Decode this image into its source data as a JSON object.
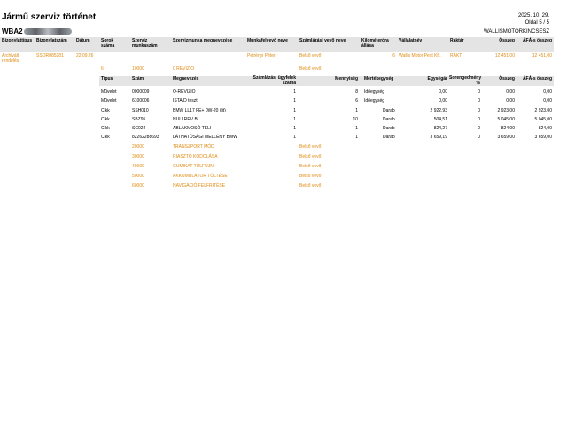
{
  "doc": {
    "title": "Jármű szerviz történet",
    "vin_prefix": "WBA2",
    "date": "2025. 10. 29.",
    "page": "Oldal 5 / 5",
    "company": "WALLISMOTORKINCSESZ"
  },
  "main_headers": {
    "type": "Bizonylattípus",
    "number": "Bizonylatszám",
    "date": "Dátum",
    "lines": "Sorok száma",
    "service_no": "Szerviz munkaszám",
    "service_name": "Szervizmunka megnevezése",
    "receiver": "Munkafelvevő neve",
    "customer": "Számlázási vevő neve",
    "km": "Kilométeróra állása",
    "company": "Vállalatnév",
    "warehouse": "Raktár",
    "total": "Összeg",
    "total_vat": "ÁFÁ-s összeg"
  },
  "doc_row": {
    "type": "Archivált rendelés",
    "number": "SSOR085281",
    "date": "22.09.26",
    "receiver": "Petrényi Péter",
    "customer": "Belső vevő",
    "km": "6",
    "company": "Wallis Motor Pest Kft.",
    "warehouse": "RAKT",
    "total": "12 451,00",
    "total_vat": "12 451,00"
  },
  "job_first": {
    "lines": "6",
    "service_no": "10000",
    "service_name": "0 REVÍZIÓ",
    "customer": "Belső vevő"
  },
  "sub_headers": {
    "type": "Típus",
    "no": "Szám",
    "name": "Megnevezés",
    "billing_qty": "Számlázási ügyfelek száma",
    "qty": "Mennyiség",
    "unit": "Mértékegység",
    "unit_price": "Egységár",
    "discount": "Sorengedmény %",
    "total": "Összeg",
    "total_vat": "ÁFÁ-s összeg"
  },
  "items": [
    {
      "type": "Művelet",
      "no": "0000009",
      "name": "O-REVÍZIÓ",
      "billing_qty": "1",
      "qty": "8",
      "unit": "Időegység",
      "unit_price": "0,00",
      "discount": "0",
      "total": "0,00",
      "total_vat": "0,00"
    },
    {
      "type": "Művelet",
      "no": "6100006",
      "name": "ISTA/D teszt",
      "billing_qty": "1",
      "qty": "6",
      "unit": "Időegység",
      "unit_price": "0,00",
      "discount": "0",
      "total": "0,00",
      "total_vat": "0,00"
    },
    {
      "type": "Cikk",
      "no": "SSH010",
      "name": "BMW LL17 FE+ 0W-20 (lit)",
      "billing_qty": "1",
      "qty": "1",
      "unit": "Darab",
      "unit_price": "2 922,93",
      "discount": "0",
      "total": "2 923,00",
      "total_vat": "2 923,00"
    },
    {
      "type": "Cikk",
      "no": "SBZ95",
      "name": "NULLREV B",
      "billing_qty": "1",
      "qty": "10",
      "unit": "Darab",
      "unit_price": "504,51",
      "discount": "0",
      "total": "5 045,00",
      "total_vat": "5 045,00"
    },
    {
      "type": "Cikk",
      "no": "SC024",
      "name": "ABLAKMOSÓ TÉLI",
      "billing_qty": "1",
      "qty": "1",
      "unit": "Darab",
      "unit_price": "824,27",
      "discount": "0",
      "total": "824,00",
      "total_vat": "824,00"
    },
    {
      "type": "Cikk",
      "no": "82262288693",
      "name": "LÁTHATÓSÁGI MELLÉNY BMW",
      "billing_qty": "1",
      "qty": "1",
      "unit": "Darab",
      "unit_price": "3 659,19",
      "discount": "0",
      "total": "3 659,00",
      "total_vat": "3 659,00"
    }
  ],
  "jobs": [
    {
      "service_no": "20000",
      "service_name": "TRANSZPORT MÓD",
      "customer": "Belső vevő"
    },
    {
      "service_no": "30000",
      "service_name": "RIASZTÓ KÓDOLÁSA",
      "customer": "Belső vevő"
    },
    {
      "service_no": "40000",
      "service_name": "GUMIKAT TÜLFÚJNI",
      "customer": "Belső vevő"
    },
    {
      "service_no": "50000",
      "service_name": "AKKUMULÁTOR TÖLTÉSE",
      "customer": "Belső vevő"
    },
    {
      "service_no": "60000",
      "service_name": "NAVIGÁCIÓ FELFRITÉSE",
      "customer": "Belső vevő"
    }
  ],
  "colors": {
    "accent_orange": "#e08a10",
    "header_gray": "#e4e4e4"
  }
}
